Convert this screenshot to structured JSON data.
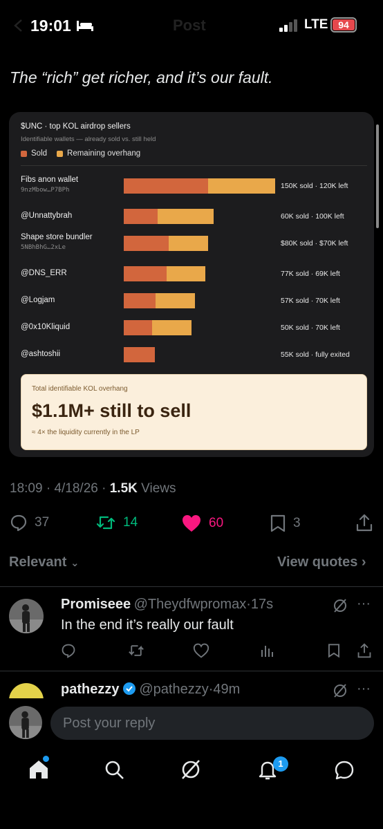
{
  "status_bar": {
    "time": "19:01",
    "network": "LTE",
    "battery": "94"
  },
  "header": {
    "title": "Post"
  },
  "tweet": {
    "text": "The “rich” get richer, and it’s our fault."
  },
  "chart_data": {
    "type": "bar",
    "title": "$UNC · top KOL airdrop sellers",
    "subtitle": "Identifiable wallets — already sold vs. still held",
    "legend": [
      "Sold",
      "Remaining overhang"
    ],
    "colors": {
      "sold": "#d2663d",
      "remaining": "#e9a84a"
    },
    "categories": [
      "Fibs anon wallet",
      "@Unnattybrah",
      "Shape store bundler",
      "@DNS_ERR",
      "@Logjam",
      "@0x10Kliquid",
      "@ashtoshii"
    ],
    "sublabels": [
      "9nzMbow…P7BPh",
      "",
      "5NBhBhG…2xLe",
      "",
      "",
      "",
      ""
    ],
    "series": [
      {
        "name": "Sold",
        "values": [
          150,
          60,
          80,
          77,
          57,
          50,
          55
        ]
      },
      {
        "name": "Remaining overhang",
        "values": [
          120,
          100,
          70,
          69,
          70,
          70,
          0
        ]
      }
    ],
    "unit": "K",
    "value_labels": [
      "150K sold · 120K left",
      "60K sold · 100K left",
      "$80K sold · $70K left",
      "77K sold · 69K left",
      "57K sold · 70K left",
      "50K sold · 70K left",
      "55K sold · fully exited"
    ],
    "callout": {
      "label": "Total identifiable KOL overhang",
      "headline": "$1.1M+ still to sell",
      "note": "≈ 4× the liquidity currently in the LP"
    }
  },
  "meta": {
    "time": "18:09",
    "date": "4/18/26",
    "views_count": "1.5K",
    "views_label": "Views"
  },
  "actions": {
    "replies": "37",
    "reposts": "14",
    "likes": "60",
    "bookmarks": "3"
  },
  "sort": {
    "relevant": "Relevant",
    "view_quotes": "View quotes"
  },
  "replies": [
    {
      "name": "Promiseee",
      "handle": "@Theydfwpromax",
      "time": "17s",
      "text": "In the end it’s really our fault"
    },
    {
      "name": "pathezzy",
      "handle": "@pathezzy",
      "time": "49m"
    }
  ],
  "reply_box": {
    "placeholder": "Post your reply"
  },
  "nav": {
    "notifications_badge": "1"
  }
}
